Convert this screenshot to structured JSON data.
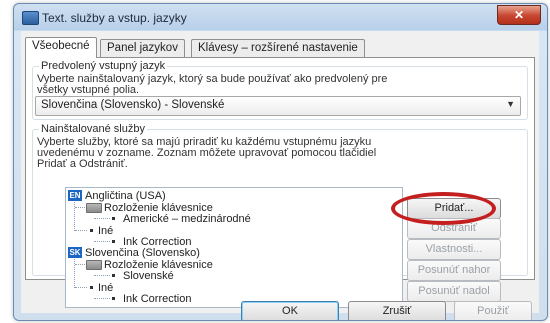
{
  "window": {
    "title": "Text. služby a vstup. jazyky",
    "close_label": "✕"
  },
  "tabs": [
    {
      "label": "Všeobecné"
    },
    {
      "label": "Panel jazykov"
    },
    {
      "label": "Klávesy – rozšírené nastavenie"
    }
  ],
  "default_language": {
    "group_title": "Predvolený vstupný jazyk",
    "description_lines": [
      "Vyberte nainštalovaný jazyk, ktorý sa bude používať ako predvolený pre",
      "všetky vstupné polia."
    ],
    "selected": "Slovenčina (Slovensko) - Slovenské",
    "arrow": "▼"
  },
  "installed_services": {
    "group_title": "Nainštalované služby",
    "description_lines": [
      "Vyberte služby, ktoré sa majú priradiť ku každému vstupnému jazyku",
      "uvedenému v zozname. Zoznam môžete upravovať pomocou tlačidiel",
      "Pridať a Odstrániť."
    ],
    "tree": [
      {
        "badge": "EN",
        "language": "Angličtina (USA)",
        "keyboard_label": "Rozloženie klávesnice",
        "keyboard": "Americké – medzinárodné",
        "other_label": "Iné",
        "other": "Ink Correction"
      },
      {
        "badge": "SK",
        "language": "Slovenčina (Slovensko)",
        "keyboard_label": "Rozloženie klávesnice",
        "keyboard": "Slovenské",
        "other_label": "Iné",
        "other": "Ink Correction"
      }
    ],
    "buttons": {
      "add": "Pridať...",
      "remove": "Odstrániť",
      "properties": "Vlastnosti...",
      "move_up": "Posunúť nahor",
      "move_down": "Posunúť nadol"
    }
  },
  "footer": {
    "ok": "OK",
    "cancel": "Zrušiť",
    "apply": "Použiť"
  },
  "colors": {
    "highlight_circle": "#c41f1f",
    "language_badge": "#1c66c3"
  },
  "icons": {
    "keyboard": "keyboard-icon",
    "app": "window-app-icon"
  }
}
